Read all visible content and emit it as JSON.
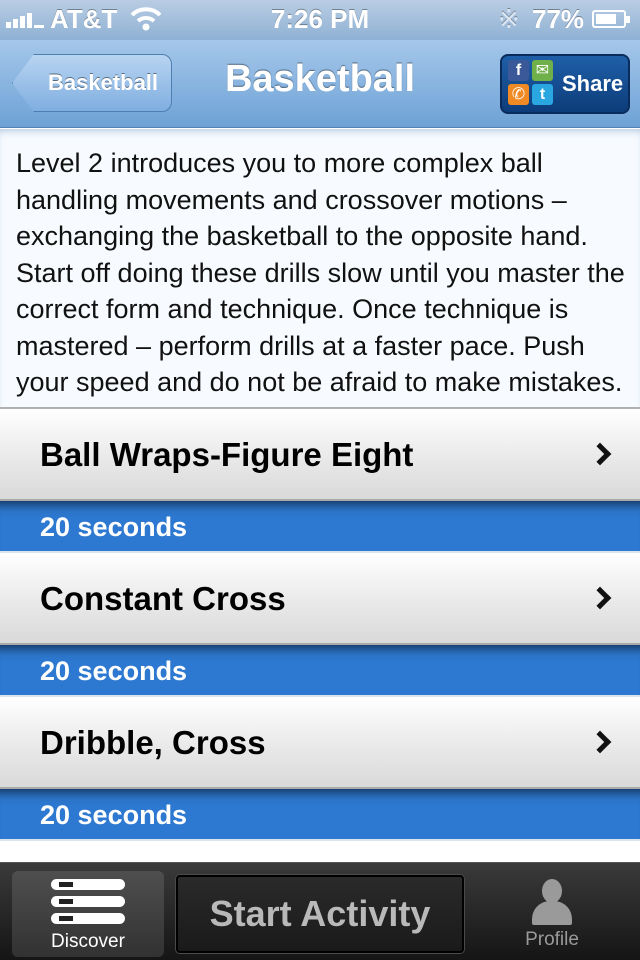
{
  "status_bar": {
    "carrier": "AT&T",
    "time": "7:26 PM",
    "battery_percent": "77%",
    "icons": [
      "signal-icon",
      "wifi-icon",
      "bluetooth-icon",
      "battery-icon"
    ]
  },
  "nav": {
    "back_label": "Basketball",
    "title": "Basketball",
    "share_label": "Share",
    "share_icons": [
      "facebook-icon",
      "email-icon",
      "phone-icon",
      "twitter-icon"
    ]
  },
  "description": "Level 2 introduces you to more complex ball handling movements and crossover motions – exchanging the basketball to the opposite hand. Start off doing these drills slow until you master the correct form and technique. Once technique is mastered – perform drills at a faster pace. Push your speed and do not be afraid to make mistakes. Once you start to feel comfortable",
  "activities": [
    {
      "name": "Ball Wraps-Figure Eight",
      "duration": "20 seconds"
    },
    {
      "name": "Constant Cross",
      "duration": "20 seconds"
    },
    {
      "name": "Dribble, Cross",
      "duration": "20 seconds"
    }
  ],
  "tab_bar": {
    "discover_label": "Discover",
    "start_label": "Start Activity",
    "profile_label": "Profile"
  },
  "colors": {
    "nav_blue": "#7fb0e0",
    "duration_blue": "#2d78d0",
    "tab_bar_dark": "#1e1e1e"
  }
}
